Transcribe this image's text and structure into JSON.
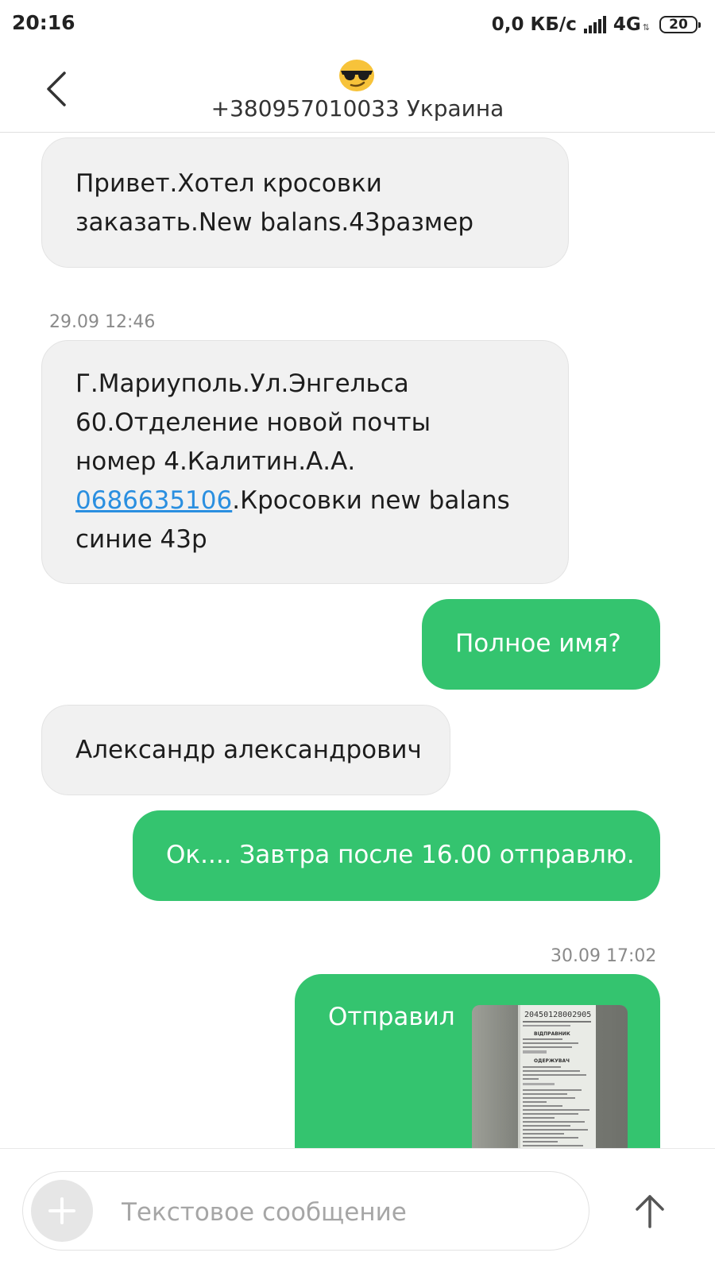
{
  "status_bar": {
    "time": "20:16",
    "network_speed": "0,0 КБ/с",
    "network_type": "4G",
    "network_arrows": "⇅",
    "battery": "20",
    "signal_icon": "signal-bars-icon"
  },
  "header": {
    "back_icon": "chevron-left-icon",
    "avatar_icon": "sunglasses-emoji-icon",
    "title": "+380957010033 Украина"
  },
  "conversation": {
    "messages": [
      {
        "direction": "incoming",
        "lines": [
          "Привет.Хотел кросовки",
          "заказать.New balans.43размер"
        ]
      },
      {
        "timestamp": "29.09 12:46",
        "direction": "incoming",
        "lines": [
          "Г.Мариуполь.Ул.Энгельса",
          "60.Отделение новой почты",
          "номер 4.Калитин.А.А."
        ],
        "link_phone": "0686635106",
        "link_suffix": ".Кросовки new balans",
        "last_line": "синие 43р"
      },
      {
        "direction": "outgoing",
        "text": "Полное имя?"
      },
      {
        "direction": "incoming",
        "text": "Александр александрович"
      },
      {
        "direction": "outgoing",
        "text": "Ок.... Завтра после 16.00 отправлю."
      },
      {
        "timestamp": "30.09 17:02",
        "direction": "outgoing",
        "text": "Отправил",
        "attachment": {
          "type": "image",
          "description_icon": "shipping-receipt-photo",
          "receipt_number": "20450128002905",
          "receipt_heading": "ВІДПРАВНИК",
          "receipt_heading_2": "ОДЕРЖУВАЧ"
        }
      }
    ]
  },
  "composer": {
    "add_icon": "plus-icon",
    "placeholder": "Текстовое сообщение",
    "value": "",
    "send_icon": "arrow-up-icon"
  },
  "colors": {
    "outgoing_bubble": "#34c46f",
    "incoming_bubble": "#f1f1f1",
    "link": "#2a8fe0",
    "timestamp": "#8a8a8a"
  }
}
